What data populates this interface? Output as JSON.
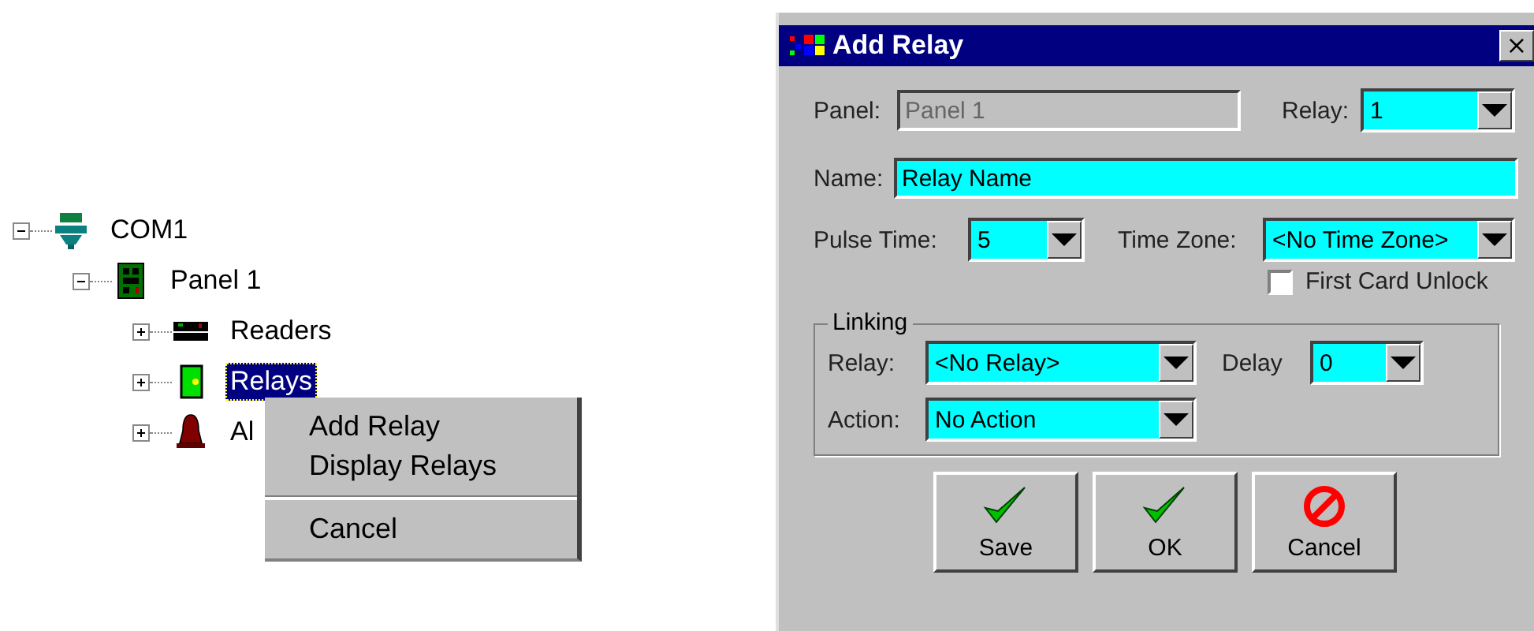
{
  "tree": [
    {
      "label": "COM1",
      "kind": "port",
      "expanded": true,
      "selected": false,
      "children": [
        {
          "label": "Panel 1",
          "kind": "panel",
          "expanded": true,
          "selected": false,
          "children": [
            {
              "label": "Readers",
              "kind": "reader",
              "expanded": false,
              "selected": false
            },
            {
              "label": "Relays",
              "kind": "relay",
              "expanded": false,
              "selected": true
            },
            {
              "label": "Al",
              "kind": "bell",
              "expanded": false,
              "selected": false
            }
          ]
        }
      ]
    }
  ],
  "context_menu": [
    {
      "kind": "item",
      "label": "Add Relay"
    },
    {
      "kind": "item",
      "label": "Display Relays"
    },
    {
      "kind": "separator"
    },
    {
      "kind": "item",
      "label": "Cancel"
    }
  ],
  "dialog": {
    "title": "Add Relay",
    "close": "×",
    "panel": {
      "label": "Panel:",
      "value": "Panel 1",
      "disabled": true
    },
    "relay": {
      "label": "Relay:",
      "value": "1"
    },
    "name": {
      "label": "Name:",
      "value": "Relay Name"
    },
    "pulse_time": {
      "label": "Pulse Time:",
      "value": "5"
    },
    "time_zone": {
      "label": "Time Zone:",
      "value": "<No Time Zone>"
    },
    "first_card_unlock": {
      "label": "First Card Unlock",
      "checked": false
    },
    "linking": {
      "title": "Linking",
      "relay": {
        "label": "Relay:",
        "value": "<No Relay>"
      },
      "delay": {
        "label": "Delay",
        "value": "0"
      },
      "action": {
        "label": "Action:",
        "value": "No Action"
      }
    },
    "buttons": [
      {
        "label": "Save",
        "kind": "confirm"
      },
      {
        "label": "OK",
        "kind": "confirm"
      },
      {
        "label": "Cancel",
        "kind": "cancel"
      }
    ]
  }
}
